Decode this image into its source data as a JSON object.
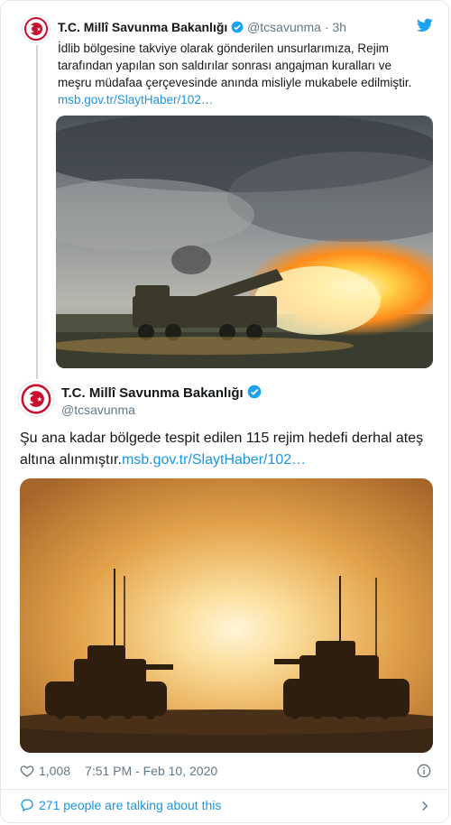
{
  "quoted": {
    "name": "T.C. Millî Savunma Bakanlığı",
    "handle": "@tcsavunma",
    "dot": "·",
    "time": "3h",
    "text_line1": "İdlib bölgesine takviye olarak gönderilen unsurlarımıza, Rejim",
    "text_line2": "tarafından yapılan son saldırılar sonrası angajman kuralları ve",
    "text_line3": "meşru müdafaa çerçevesinde anında misliyle mukabele edilmiştir.",
    "link": "msb.gov.tr/SlaytHaber/102…"
  },
  "main": {
    "name": "T.C. Millî Savunma Bakanlığı",
    "handle": "@tcsavunma",
    "text_line1": "Şu ana kadar bölgede tespit edilen 115 rejim hedefi derhal ateş",
    "text_line2_prefix": "altına alınmıştır.",
    "link": "msb.gov.tr/SlaytHaber/102…"
  },
  "footer": {
    "likes": "1,008",
    "timestamp": "7:51 PM - Feb 10, 2020",
    "talking": "271 people are talking about this"
  },
  "colors": {
    "accent": "#1b95e0",
    "verified": "#1da1f2",
    "border": "#e1e8ed",
    "muted": "#657786",
    "logo_red": "#c8102e"
  },
  "icons": [
    "twitter-bird-icon",
    "verified-icon",
    "heart-icon",
    "info-icon",
    "speech-bubble-icon",
    "chevron-right-icon"
  ]
}
